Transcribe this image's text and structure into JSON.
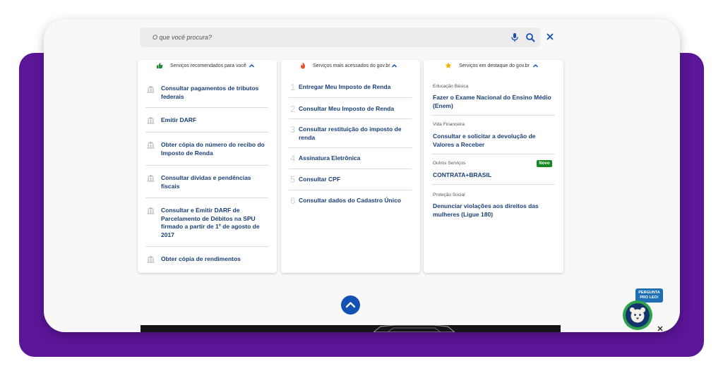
{
  "search": {
    "placeholder": "O que você procura?"
  },
  "columns": [
    {
      "title": "Serviços recomendados para você",
      "items": [
        "Consultar pagamentos de tributos federais",
        "Emitir DARF",
        "Obter cópia do número do recibo do Imposto de Renda",
        "Consultar dívidas e pendências fiscais",
        "Consultar e Emitir DARF de Parcelamento de Débitos na SPU firmado a partir de 1º de agosto de 2017",
        "Obter cópia de rendimentos"
      ]
    },
    {
      "title": "Serviços mais acessados do gov.br",
      "items": [
        {
          "num": "1",
          "label": "Entregar Meu Imposto de Renda"
        },
        {
          "num": "2",
          "label": "Consultar Meu Imposto de Renda"
        },
        {
          "num": "3",
          "label": "Consultar restituição do imposto de renda"
        },
        {
          "num": "4",
          "label": "Assinatura Eletrônica"
        },
        {
          "num": "5",
          "label": "Consultar CPF"
        },
        {
          "num": "6",
          "label": "Consultar dados do Cadastro Único"
        }
      ]
    },
    {
      "title": "Serviços em destaque do gov.br",
      "items": [
        {
          "category": "Educação Básica",
          "label": "Fazer o Exame Nacional do Ensino Médio (Enem)"
        },
        {
          "category": "Vida Financeira",
          "label": "Consultar e solicitar a devolução de Valores a Receber"
        },
        {
          "category": "Outros Serviços",
          "label": "CONTRATA+BRASIL",
          "badge": "Novo"
        },
        {
          "category": "Proteção Social",
          "label": "Denunciar violações aos direitos das mulheres (Ligue 180)"
        }
      ]
    }
  ],
  "assistant": {
    "badge_line1": "PERGUNTA",
    "badge_line2": "PRO LEO!"
  },
  "icons": {
    "recommended": "thumbs-up-icon",
    "most_accessed": "flame-icon",
    "featured": "star-icon",
    "collapse": "chevron-up-icon",
    "item": "bank-icon"
  },
  "colors": {
    "purple": "#5b1597",
    "link": "#1a3f78",
    "primary": "#1351b4",
    "new_badge": "#168821"
  }
}
